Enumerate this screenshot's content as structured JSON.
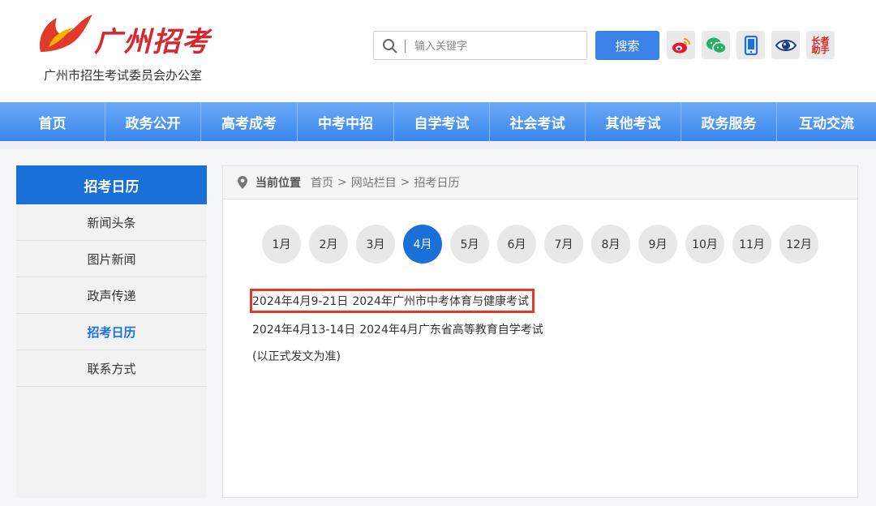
{
  "header": {
    "logo_text": "广州招考",
    "logo_subtitle": "广州市招生考试委员会办公室",
    "search": {
      "placeholder": "输入关键字",
      "button_label": "搜索"
    },
    "social": [
      {
        "name": "weibo-icon"
      },
      {
        "name": "wechat-icon"
      },
      {
        "name": "mobile-icon"
      },
      {
        "name": "eye-icon"
      },
      {
        "name": "elder-assistant-icon",
        "label": "长者助手"
      }
    ]
  },
  "nav": {
    "items": [
      "首页",
      "政务公开",
      "高考成考",
      "中考中招",
      "自学考试",
      "社会考试",
      "其他考试",
      "政务服务",
      "互动交流"
    ]
  },
  "sidebar": {
    "title": "招考日历",
    "items": [
      {
        "label": "新闻头条",
        "active": false
      },
      {
        "label": "图片新闻",
        "active": false
      },
      {
        "label": "政声传递",
        "active": false
      },
      {
        "label": "招考日历",
        "active": true
      },
      {
        "label": "联系方式",
        "active": false
      }
    ]
  },
  "breadcrumb": {
    "title": "当前位置",
    "links": [
      "首页",
      "网站栏目",
      "招考日历"
    ],
    "separator": ">"
  },
  "calendar": {
    "months": [
      "1月",
      "2月",
      "3月",
      "4月",
      "5月",
      "6月",
      "7月",
      "8月",
      "9月",
      "10月",
      "11月",
      "12月"
    ],
    "selected": "4月"
  },
  "events": [
    {
      "time": "2024年4月9-21日",
      "title": "2024年广州市中考体育与健康考试",
      "highlighted": true
    },
    {
      "time": "2024年4月13-14日",
      "title": "2024年4月广东省高等教育自学考试",
      "highlighted": false
    }
  ],
  "note": "(以正式发文为准)",
  "colors": {
    "brand_red": "#d7282f",
    "nav_blue": "#3b86ee",
    "active_blue": "#1b6fd8",
    "highlight_red": "#e23a2a"
  }
}
